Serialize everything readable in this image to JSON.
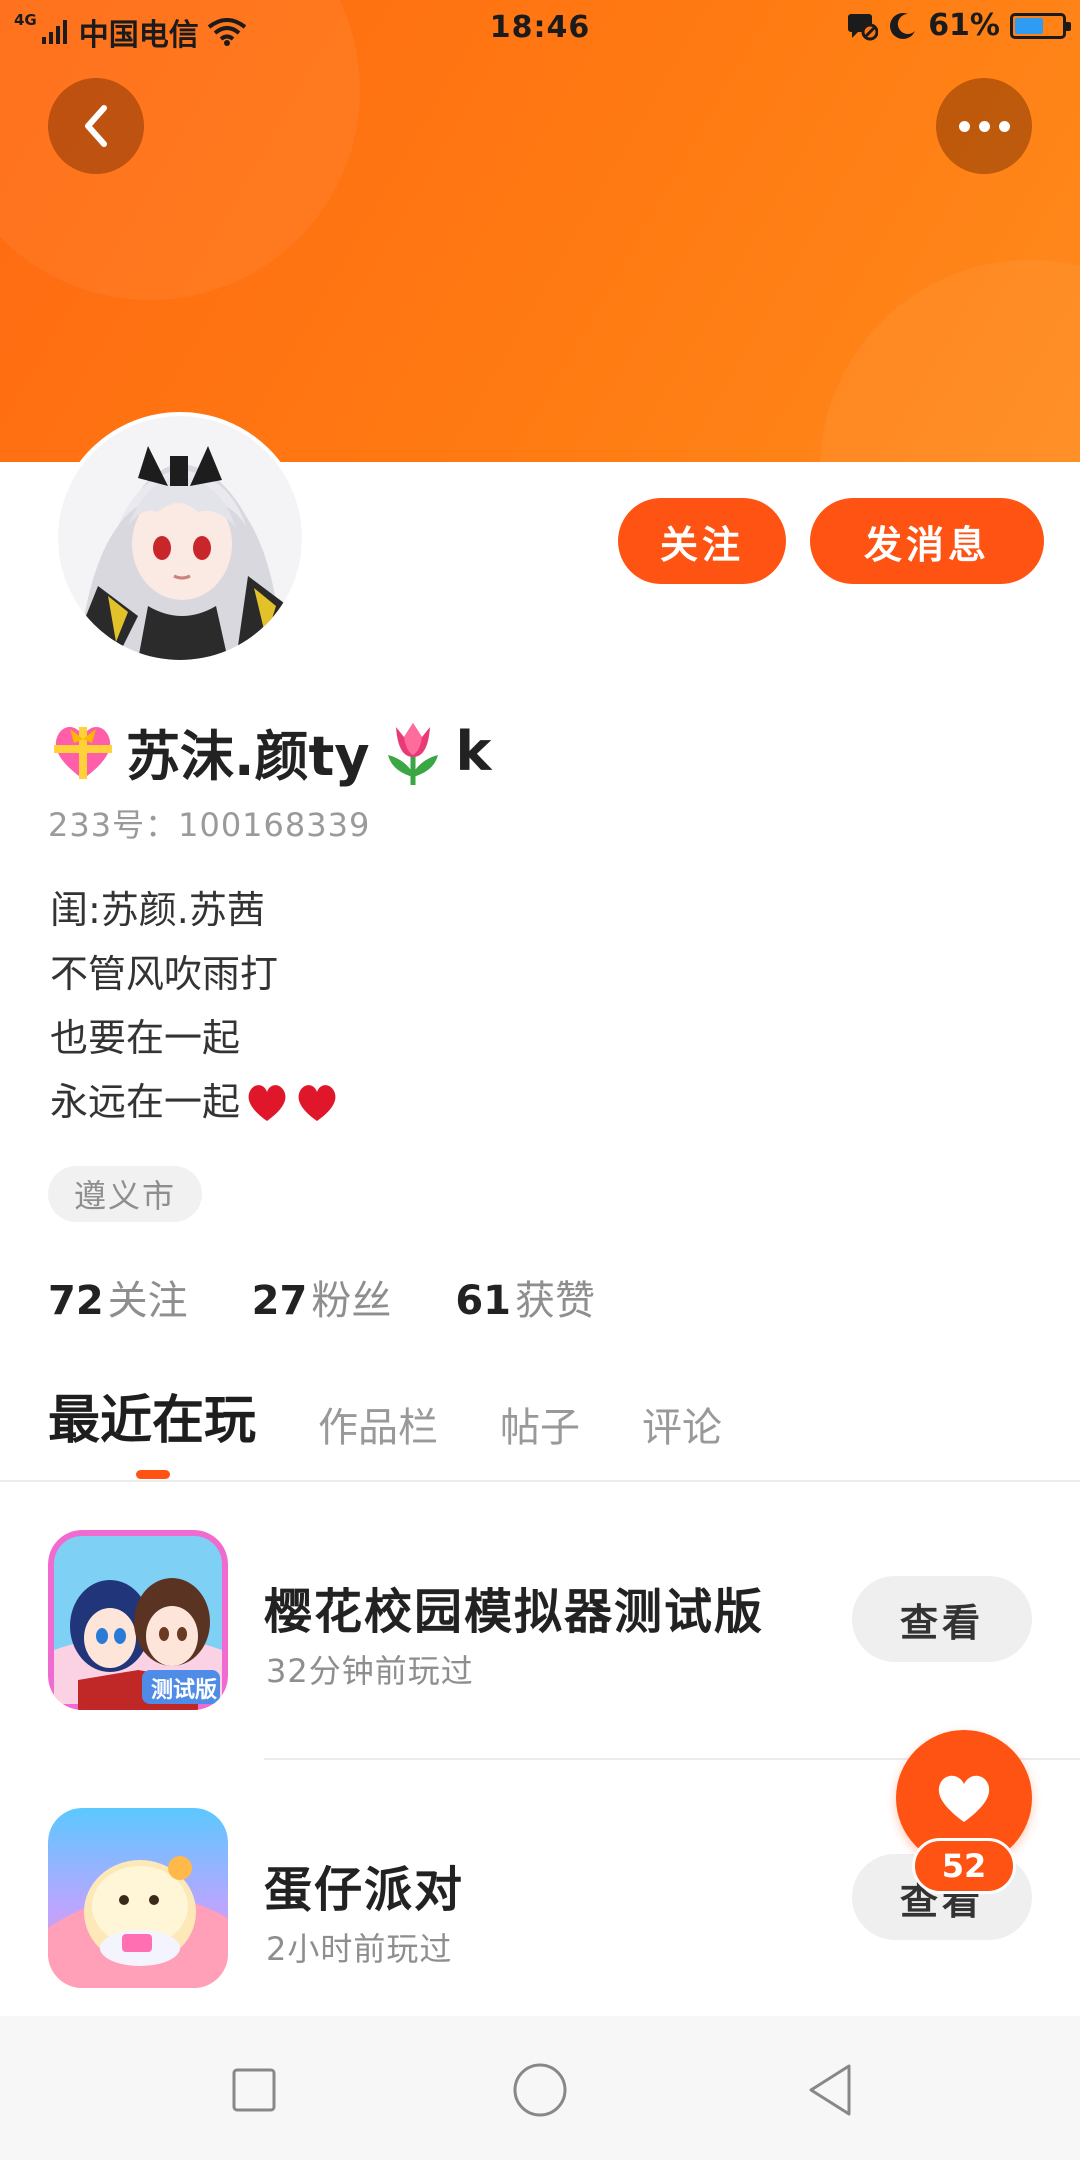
{
  "status_bar": {
    "network_type": "4G",
    "carrier": "中国电信",
    "time": "18:46",
    "battery_percent": "61%",
    "battery_level": 0.61,
    "battery_color": "#2e9cf3"
  },
  "header": {
    "background_color": "#ff7412",
    "back_icon": "chevron-left-icon",
    "more_icon": "more-dots-icon"
  },
  "profile": {
    "username_prefix_emoji": "gift-heart-emoji",
    "username_part1": "苏沫.颜ty",
    "username_mid_emoji": "tulip-emoji",
    "username_part2": "k",
    "uid_label": "233号：",
    "uid": "100168339",
    "follow_label": "关注",
    "message_label": "发消息",
    "bio_lines": [
      "闺:苏颜.苏茜",
      "不管风吹雨打",
      "也要在一起",
      "永远在一起"
    ],
    "bio_trailing_emoji": "red-heart-emoji",
    "location": "遵义市",
    "stats": [
      {
        "num": "72",
        "label": "关注"
      },
      {
        "num": "27",
        "label": "粉丝"
      },
      {
        "num": "61",
        "label": "获赞"
      }
    ]
  },
  "tabs": [
    {
      "label": "最近在玩",
      "active": true
    },
    {
      "label": "作品栏",
      "active": false
    },
    {
      "label": "帖子",
      "active": false
    },
    {
      "label": "评论",
      "active": false
    }
  ],
  "games": [
    {
      "title": "樱花校园模拟器测试版",
      "subtitle": "32分钟前玩过",
      "icon_badge": "测试版",
      "button": "查看"
    },
    {
      "title": "蛋仔派对",
      "subtitle": "2小时前玩过",
      "button": "查看"
    }
  ],
  "like_fab": {
    "icon": "heart-icon",
    "count": "52"
  },
  "nav_bar": {
    "items": [
      "recent-apps-square-icon",
      "home-circle-icon",
      "back-triangle-icon"
    ]
  },
  "accent_color": "#ff5314"
}
